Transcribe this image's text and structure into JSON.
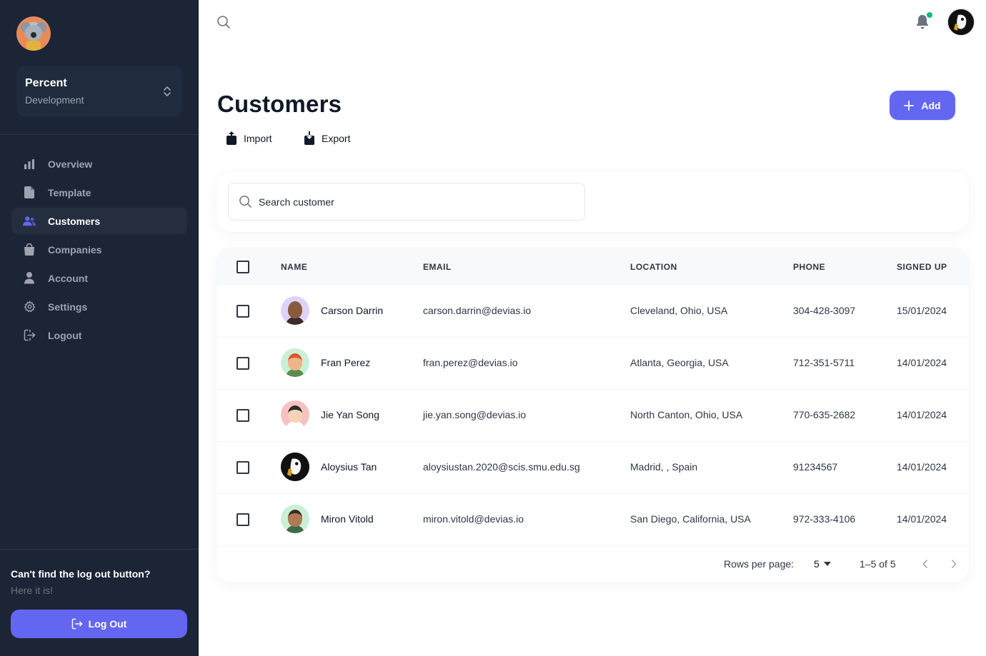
{
  "sidebar": {
    "workspace": {
      "name": "Percent",
      "sub": "Development"
    },
    "nav": [
      {
        "label": "Overview",
        "icon": "chart-bar-icon",
        "active": false
      },
      {
        "label": "Template",
        "icon": "document-icon",
        "active": false
      },
      {
        "label": "Customers",
        "icon": "users-icon",
        "active": true
      },
      {
        "label": "Companies",
        "icon": "shopping-bag-icon",
        "active": false
      },
      {
        "label": "Account",
        "icon": "user-icon",
        "active": false
      },
      {
        "label": "Settings",
        "icon": "cog-icon",
        "active": false
      },
      {
        "label": "Logout",
        "icon": "logout-icon",
        "active": false
      }
    ],
    "help_title": "Can't find the log out button?",
    "help_sub": "Here it is!",
    "logout_label": "Log Out"
  },
  "header": {
    "title": "Customers",
    "import_label": "Import",
    "export_label": "Export",
    "add_label": "Add"
  },
  "search": {
    "placeholder": "Search customer"
  },
  "table": {
    "columns": [
      "NAME",
      "EMAIL",
      "LOCATION",
      "PHONE",
      "SIGNED UP"
    ],
    "rows": [
      {
        "name": "Carson Darrin",
        "email": "carson.darrin@devias.io",
        "location": "Cleveland, Ohio, USA",
        "phone": "304-428-3097",
        "signed_up": "15/01/2024"
      },
      {
        "name": "Fran Perez",
        "email": "fran.perez@devias.io",
        "location": "Atlanta, Georgia, USA",
        "phone": "712-351-5711",
        "signed_up": "14/01/2024"
      },
      {
        "name": "Jie Yan Song",
        "email": "jie.yan.song@devias.io",
        "location": "North Canton, Ohio, USA",
        "phone": "770-635-2682",
        "signed_up": "14/01/2024"
      },
      {
        "name": "Aloysius Tan",
        "email": "aloysiustan.2020@scis.smu.edu.sg",
        "location": "Madrid, , Spain",
        "phone": "91234567",
        "signed_up": "14/01/2024"
      },
      {
        "name": "Miron Vitold",
        "email": "miron.vitold@devias.io",
        "location": "San Diego, California, USA",
        "phone": "972-333-4106",
        "signed_up": "14/01/2024"
      }
    ]
  },
  "pagination": {
    "rows_per_page_label": "Rows per page:",
    "rows_per_page": "5",
    "range": "1–5 of 5"
  },
  "colors": {
    "sidebar_bg": "#1c2536",
    "accent": "#6366f1",
    "notification_dot": "#10b981"
  }
}
